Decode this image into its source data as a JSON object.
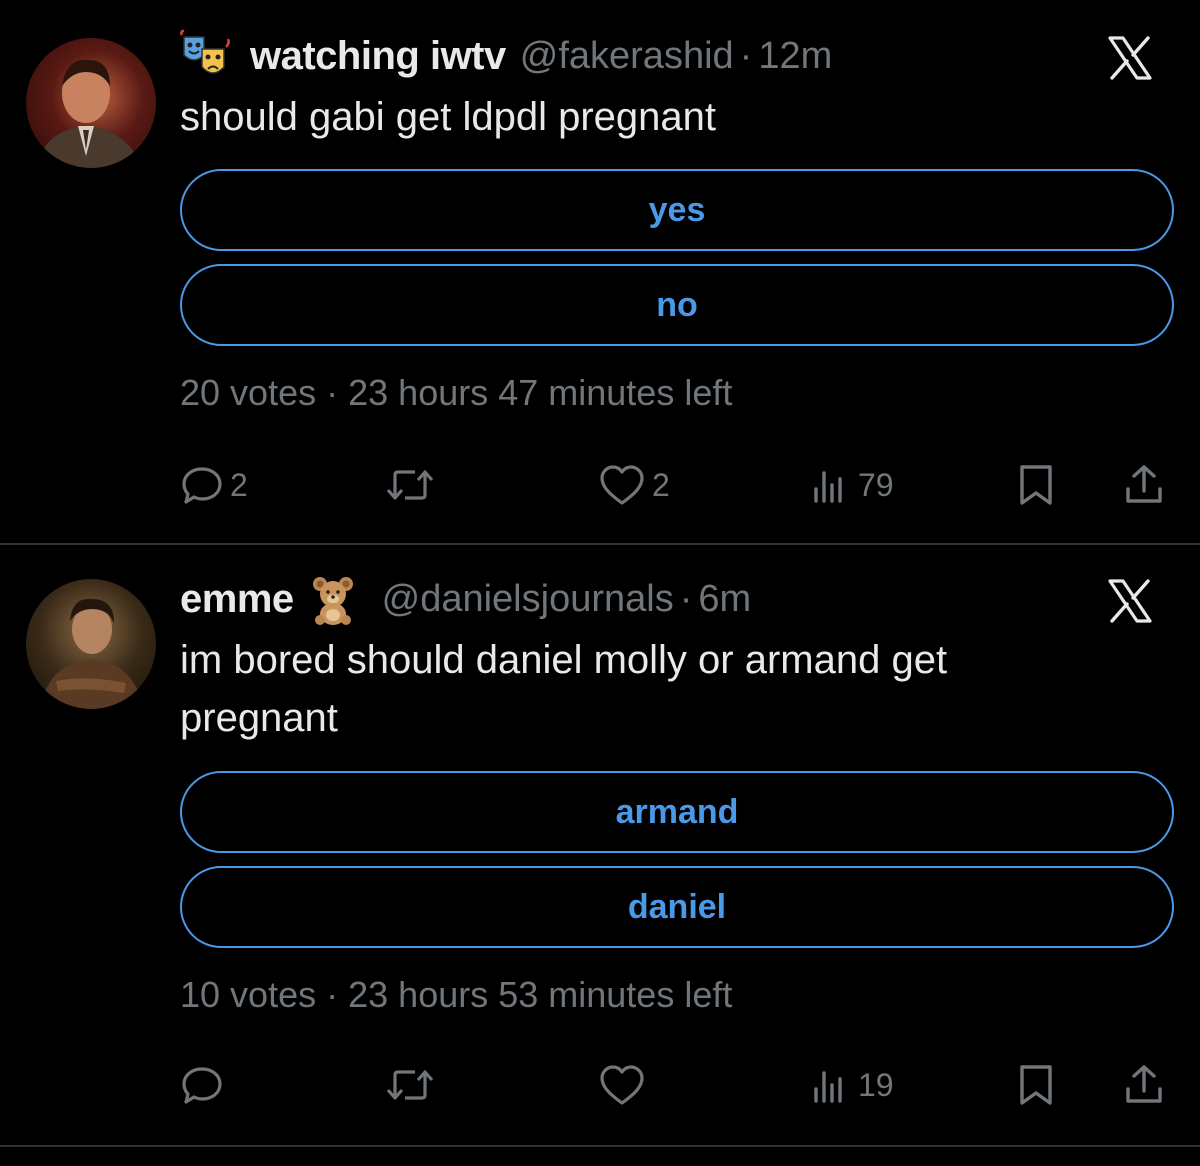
{
  "tweets": [
    {
      "display_name": "watching iwtv",
      "emoji": "performing-arts-emoji",
      "handle": "@fakerashid",
      "separator": "·",
      "time": "12m",
      "text": "should gabi get ldpdl pregnant",
      "poll": {
        "options": [
          "yes",
          "no"
        ],
        "votes": "20 votes",
        "separator": "·",
        "time_left": "23 hours 47 minutes left"
      },
      "actions": {
        "replies": "2",
        "reposts": "",
        "likes": "2",
        "views": "79"
      }
    },
    {
      "display_name": "emme",
      "emoji": "teddy-bear-emoji",
      "handle": "@danielsjournals",
      "separator": "·",
      "time": "6m",
      "text": "im bored should daniel molly or armand get pregnant",
      "poll": {
        "options": [
          "armand",
          "daniel"
        ],
        "votes": "10 votes",
        "separator": "·",
        "time_left": "23 hours 53 minutes left"
      },
      "actions": {
        "replies": "",
        "reposts": "",
        "likes": "",
        "views": "19"
      }
    }
  ],
  "colors": {
    "accent": "#4a99e9",
    "muted": "#71767b",
    "text": "#e7e9ea",
    "background": "#000000",
    "divider": "#2f3336"
  }
}
